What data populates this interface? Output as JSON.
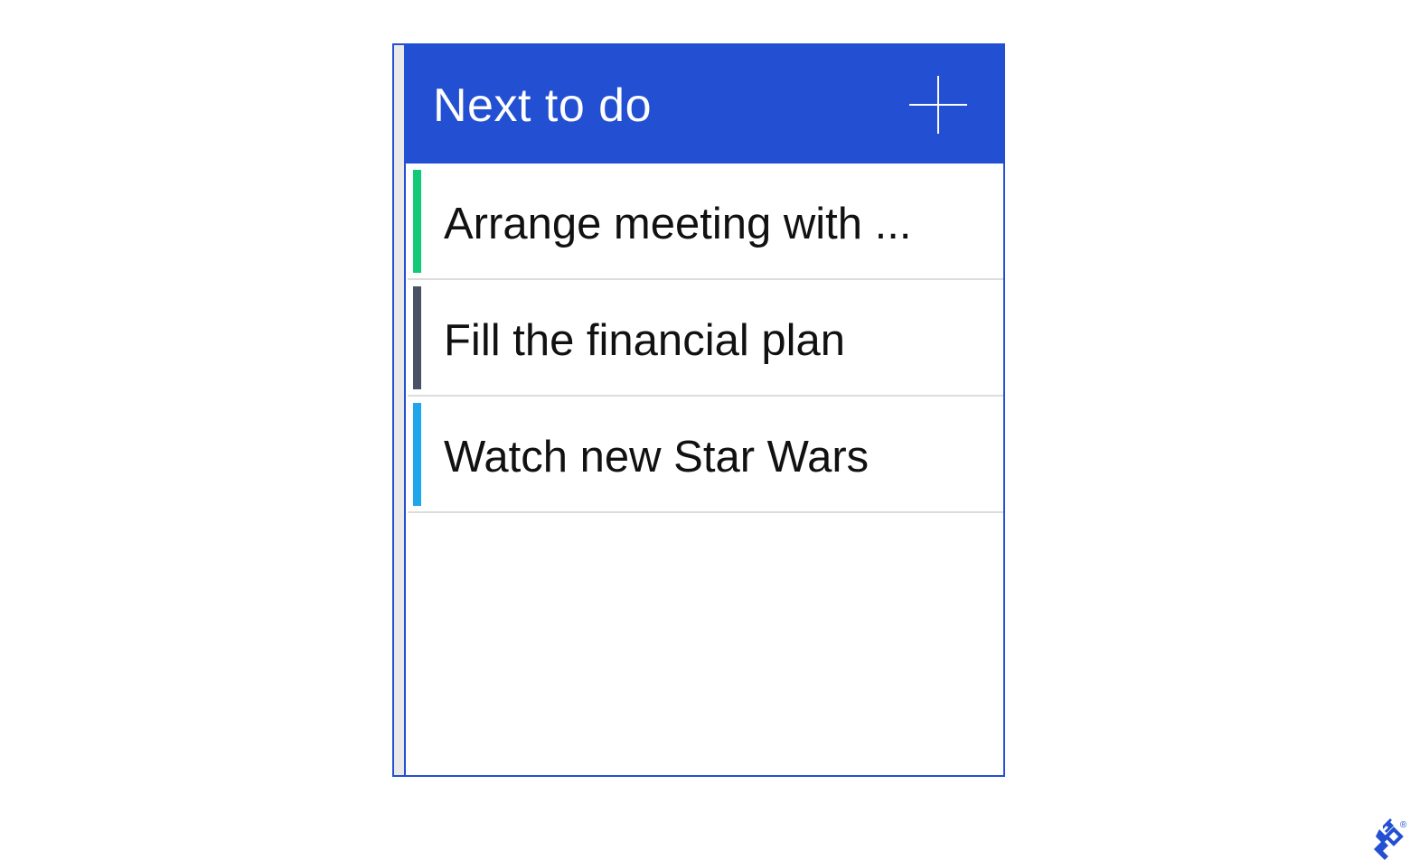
{
  "panel": {
    "title": "Next to do",
    "add_icon": "plus-icon"
  },
  "tasks": [
    {
      "label": "Arrange meeting with ...",
      "color": "#12c97a"
    },
    {
      "label": "Fill the financial plan",
      "color": "#4a5066"
    },
    {
      "label": "Watch new Star Wars",
      "color": "#1fa5ec"
    }
  ],
  "colors": {
    "accent": "#2350d2",
    "divider": "#dcdcdc",
    "gutter": "#e9e9e9"
  },
  "brand": {
    "icon": "toptal-logo-icon",
    "mark": "®"
  }
}
